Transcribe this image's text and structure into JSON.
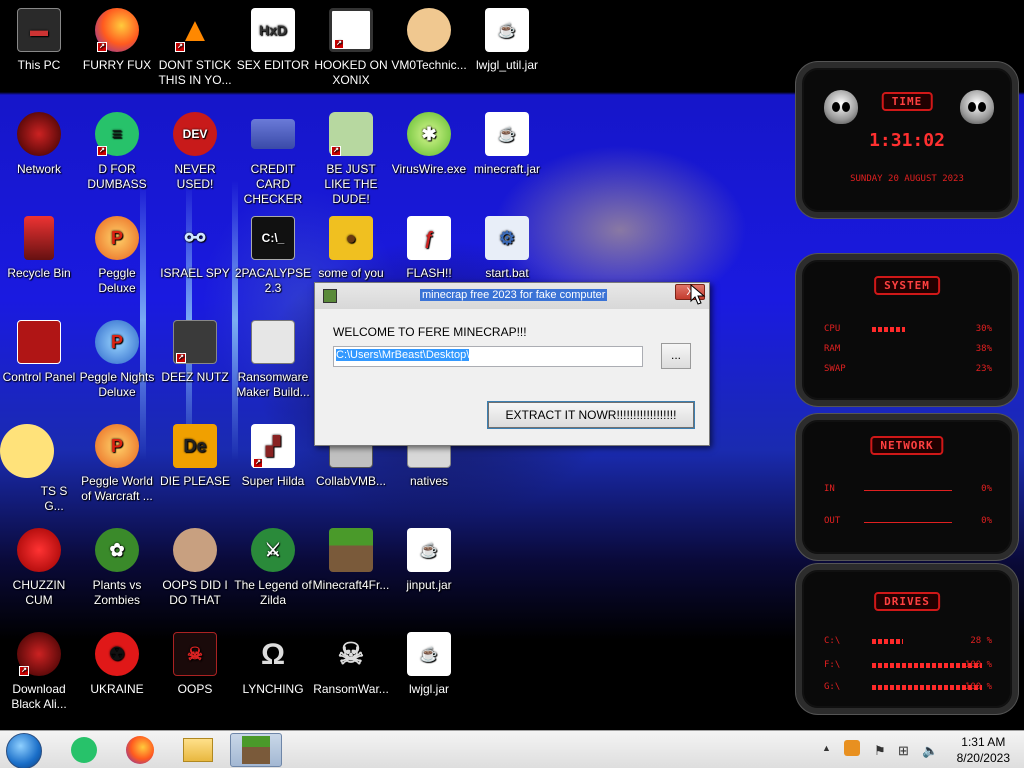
{
  "desktop": {
    "icons": [
      {
        "label": "This PC"
      },
      {
        "label": "FURRY FUX"
      },
      {
        "label": "DONT STICK THIS IN YO..."
      },
      {
        "label": "SEX EDITOR"
      },
      {
        "label": "HOOKED ON XONIX"
      },
      {
        "label": "VM0Technic..."
      },
      {
        "label": "lwjgl_util.jar"
      },
      {
        "label": "Network"
      },
      {
        "label": "D FOR DUMBASS"
      },
      {
        "label": "NEVER USED!"
      },
      {
        "label": "CREDIT CARD CHECKER"
      },
      {
        "label": "BE JUST LIKE THE DUDE!"
      },
      {
        "label": "VirusWire.exe"
      },
      {
        "label": "minecraft.jar"
      },
      {
        "label": "Recycle Bin"
      },
      {
        "label": "Peggle Deluxe"
      },
      {
        "label": "ISRAEL SPY"
      },
      {
        "label": "2PACALYPSE 2.3"
      },
      {
        "label": "some of you need to ac..."
      },
      {
        "label": "FLASH!!"
      },
      {
        "label": "start.bat"
      },
      {
        "label": "Control Panel"
      },
      {
        "label": "Peggle Nights Deluxe"
      },
      {
        "label": "DEEZ NUTZ"
      },
      {
        "label": "Ransomware Maker Build..."
      },
      {
        "label": "TS S G..."
      },
      {
        "label": "Peggle World of Warcraft ..."
      },
      {
        "label": "DIE PLEASE"
      },
      {
        "label": "Super Hilda"
      },
      {
        "label": "CollabVMB..."
      },
      {
        "label": "natives"
      },
      {
        "label": "CHUZZIN CUM"
      },
      {
        "label": "Plants vs Zombies"
      },
      {
        "label": "OOPS DID I DO THAT"
      },
      {
        "label": "The Legend of Zilda"
      },
      {
        "label": "Minecraft4Fr..."
      },
      {
        "label": "jinput.jar"
      },
      {
        "label": "Download Black Ali..."
      },
      {
        "label": "UKRAINE"
      },
      {
        "label": "OOPS"
      },
      {
        "label": "LYNCHING"
      },
      {
        "label": "RansomWar..."
      },
      {
        "label": "lwjgl.jar"
      }
    ]
  },
  "dialog": {
    "title": "minecrap free 2023 for fake computer",
    "close_label": "X",
    "welcome": "WELCOME TO FERE MINECRAP!!!",
    "path_value": "C:\\Users\\MrBeast\\Desktop\\",
    "browse_label": "...",
    "extract_label": "EXTRACT IT NOWR!!!!!!!!!!!!!!!!!!"
  },
  "gadgets": {
    "time": {
      "title": "TIME",
      "clock": "1:31:02",
      "date": "SUNDAY 20 AUGUST 2023"
    },
    "system": {
      "title": "SYSTEM",
      "rows": [
        {
          "key": "CPU",
          "value": "30%",
          "level": 0.3
        },
        {
          "key": "RAM",
          "value": "38%",
          "level": 0.38
        },
        {
          "key": "SWAP",
          "value": "23%",
          "level": 0.23
        }
      ]
    },
    "network": {
      "title": "NETWORK",
      "rows": [
        {
          "key": "IN",
          "value": "0%"
        },
        {
          "key": "OUT",
          "value": "0%"
        }
      ]
    },
    "drives": {
      "title": "DRIVES",
      "rows": [
        {
          "key": "C:\\",
          "value": "28 %",
          "level": 0.28
        },
        {
          "key": "F:\\",
          "value": "100 %",
          "level": 1.0
        },
        {
          "key": "G:\\",
          "value": "100 %",
          "level": 1.0
        }
      ]
    }
  },
  "taskbar": {
    "clock_time": "1:31 AM",
    "clock_date": "8/20/2023"
  },
  "colors": {
    "accent_red": "#e02020",
    "taskbar": "#e6e6e6"
  }
}
